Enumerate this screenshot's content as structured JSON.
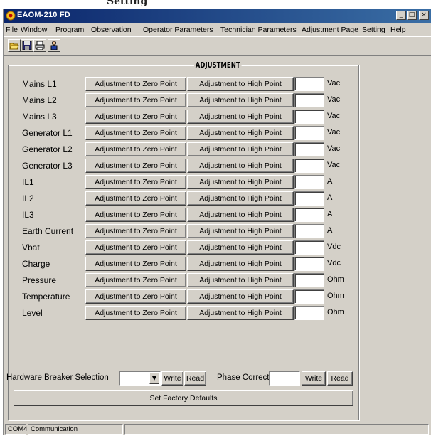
{
  "caption": {
    "text": "Setting"
  },
  "window": {
    "title": "EAOM-210 FD"
  },
  "title_buttons": [
    "_",
    "□",
    "×"
  ],
  "menu": {
    "items": [
      {
        "label": "File",
        "key": "F"
      },
      {
        "label": "Window",
        "key": "W"
      },
      {
        "label": "Program",
        "key": "P"
      },
      {
        "label": "Observation",
        "key": "b"
      },
      {
        "label": "Operator Parameters",
        "key": "O"
      },
      {
        "label": "Technician Parameters",
        "key": "T"
      },
      {
        "label": "Adjustment Page",
        "key": "A"
      },
      {
        "label": "Setting",
        "key": "S"
      },
      {
        "label": "Help",
        "key": "H"
      }
    ]
  },
  "toolbar": {
    "icons": [
      "open-folder-icon",
      "save-disk-icon",
      "print-icon",
      "user-icon"
    ]
  },
  "panel": {
    "title": "ADJUSTMENT"
  },
  "buttons": {
    "zero_label": "Adjustment to Zero Point",
    "high_label": "Adjustment to High Point",
    "write_label": "Write",
    "read_label": "Read",
    "factory_label": "Set Factory Defaults"
  },
  "rows": [
    {
      "label": "Mains L1",
      "unit": "Vac",
      "value": ""
    },
    {
      "label": "Mains L2",
      "unit": "Vac",
      "value": ""
    },
    {
      "label": "Mains L3",
      "unit": "Vac",
      "value": ""
    },
    {
      "label": "Generator L1",
      "unit": "Vac",
      "value": ""
    },
    {
      "label": "Generator L2",
      "unit": "Vac",
      "value": ""
    },
    {
      "label": "Generator L3",
      "unit": "Vac",
      "value": ""
    },
    {
      "label": "IL1",
      "unit": "A",
      "value": ""
    },
    {
      "label": "IL2",
      "unit": "A",
      "value": ""
    },
    {
      "label": "IL3",
      "unit": "A",
      "value": ""
    },
    {
      "label": "Earth Current",
      "unit": "A",
      "value": ""
    },
    {
      "label": "Vbat",
      "unit": "Vdc",
      "value": ""
    },
    {
      "label": "Charge",
      "unit": "Vdc",
      "value": ""
    },
    {
      "label": "Pressure",
      "unit": "Ohm",
      "value": ""
    },
    {
      "label": "Temperature",
      "unit": "Ohm",
      "value": ""
    },
    {
      "label": "Level",
      "unit": "Ohm",
      "value": ""
    }
  ],
  "hardware": {
    "label": "Hardware Breaker Selection",
    "selected": ""
  },
  "phase": {
    "label": "Phase Correction",
    "value": ""
  },
  "status": {
    "port": "COM4",
    "text": "Communication"
  },
  "colors": {
    "titlebar_start": "#0a246a",
    "titlebar_end": "#3a6ea5",
    "face": "#d4d0c8"
  }
}
